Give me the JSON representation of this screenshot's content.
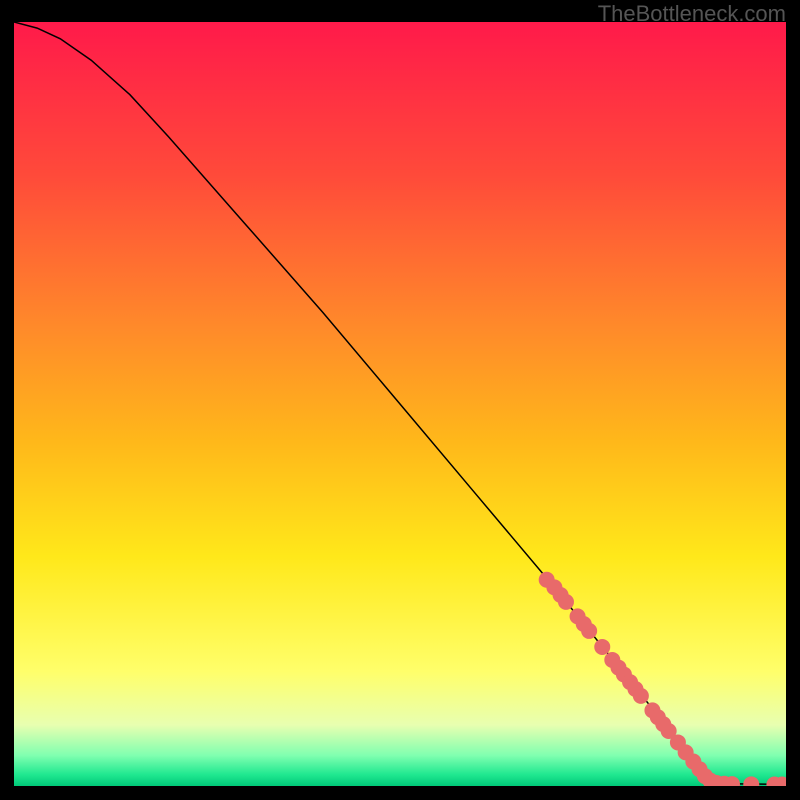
{
  "watermark": "TheBottleneck.com",
  "chart_data": {
    "type": "line",
    "title": "",
    "xlabel": "",
    "ylabel": "",
    "xlim": [
      0,
      100
    ],
    "ylim": [
      0,
      100
    ],
    "grid": false,
    "background": {
      "type": "vertical_gradient",
      "stops": [
        {
          "pos": 0.0,
          "color": "#ff1a4a"
        },
        {
          "pos": 0.2,
          "color": "#ff4a3a"
        },
        {
          "pos": 0.4,
          "color": "#ff8a2a"
        },
        {
          "pos": 0.55,
          "color": "#ffb81a"
        },
        {
          "pos": 0.7,
          "color": "#ffe81a"
        },
        {
          "pos": 0.85,
          "color": "#ffff6a"
        },
        {
          "pos": 0.92,
          "color": "#e8ffb0"
        },
        {
          "pos": 0.96,
          "color": "#80ffb0"
        },
        {
          "pos": 0.985,
          "color": "#20e890"
        },
        {
          "pos": 1.0,
          "color": "#00c878"
        }
      ]
    },
    "curve": {
      "color": "#000000",
      "width": 1.5,
      "points": [
        {
          "x": 0,
          "y": 100
        },
        {
          "x": 3,
          "y": 99.2
        },
        {
          "x": 6,
          "y": 97.8
        },
        {
          "x": 10,
          "y": 95.0
        },
        {
          "x": 15,
          "y": 90.5
        },
        {
          "x": 20,
          "y": 85.0
        },
        {
          "x": 30,
          "y": 73.5
        },
        {
          "x": 40,
          "y": 62.0
        },
        {
          "x": 50,
          "y": 50.0
        },
        {
          "x": 60,
          "y": 38.0
        },
        {
          "x": 70,
          "y": 26.0
        },
        {
          "x": 80,
          "y": 13.5
        },
        {
          "x": 88,
          "y": 3.5
        },
        {
          "x": 90,
          "y": 1.0
        },
        {
          "x": 92,
          "y": 0.3
        },
        {
          "x": 100,
          "y": 0.2
        }
      ]
    },
    "markers": {
      "color": "#e86a6a",
      "radius": 8,
      "points": [
        {
          "x": 69,
          "y": 27
        },
        {
          "x": 70,
          "y": 26
        },
        {
          "x": 70.8,
          "y": 25
        },
        {
          "x": 71.5,
          "y": 24.1
        },
        {
          "x": 73,
          "y": 22.2
        },
        {
          "x": 73.8,
          "y": 21.2
        },
        {
          "x": 74.5,
          "y": 20.3
        },
        {
          "x": 76.2,
          "y": 18.2
        },
        {
          "x": 77.5,
          "y": 16.5
        },
        {
          "x": 78.3,
          "y": 15.5
        },
        {
          "x": 79,
          "y": 14.6
        },
        {
          "x": 79.8,
          "y": 13.6
        },
        {
          "x": 80.5,
          "y": 12.7
        },
        {
          "x": 81.2,
          "y": 11.8
        },
        {
          "x": 82.7,
          "y": 9.9
        },
        {
          "x": 83.4,
          "y": 9.0
        },
        {
          "x": 84.1,
          "y": 8.1
        },
        {
          "x": 84.8,
          "y": 7.2
        },
        {
          "x": 86,
          "y": 5.7
        },
        {
          "x": 87,
          "y": 4.4
        },
        {
          "x": 88,
          "y": 3.2
        },
        {
          "x": 88.8,
          "y": 2.2
        },
        {
          "x": 89.5,
          "y": 1.3
        },
        {
          "x": 90.2,
          "y": 0.7
        },
        {
          "x": 91,
          "y": 0.4
        },
        {
          "x": 92,
          "y": 0.3
        },
        {
          "x": 93,
          "y": 0.25
        },
        {
          "x": 95.5,
          "y": 0.22
        },
        {
          "x": 98.5,
          "y": 0.2
        },
        {
          "x": 99.5,
          "y": 0.2
        }
      ]
    }
  }
}
